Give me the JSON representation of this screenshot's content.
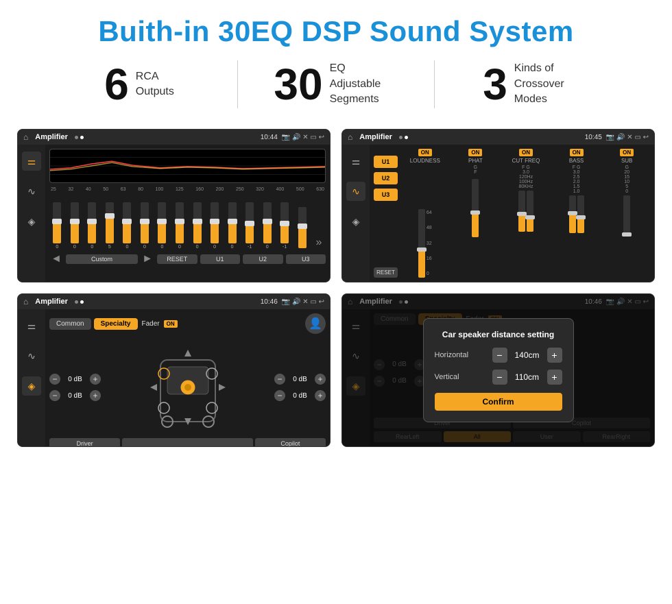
{
  "page": {
    "title": "Buith-in 30EQ DSP Sound System"
  },
  "stats": [
    {
      "number": "6",
      "label": "RCA\nOutputs"
    },
    {
      "number": "30",
      "label": "EQ Adjustable\nSegments"
    },
    {
      "number": "3",
      "label": "Kinds of\nCrossover Modes"
    }
  ],
  "screens": [
    {
      "id": "eq-screen",
      "status_bar": {
        "app": "Amplifier",
        "time": "10:44"
      }
    },
    {
      "id": "crossover-screen",
      "status_bar": {
        "app": "Amplifier",
        "time": "10:45"
      }
    },
    {
      "id": "fader-screen",
      "status_bar": {
        "app": "Amplifier",
        "time": "10:46"
      }
    },
    {
      "id": "distance-screen",
      "status_bar": {
        "app": "Amplifier",
        "time": "10:46"
      },
      "dialog": {
        "title": "Car speaker distance setting",
        "horizontal_label": "Horizontal",
        "horizontal_value": "140cm",
        "vertical_label": "Vertical",
        "vertical_value": "110cm",
        "confirm_label": "Confirm"
      }
    }
  ],
  "eq": {
    "freqs": [
      "25",
      "32",
      "40",
      "50",
      "63",
      "80",
      "100",
      "125",
      "160",
      "200",
      "250",
      "320",
      "400",
      "500",
      "630"
    ],
    "values": [
      "0",
      "0",
      "0",
      "5",
      "0",
      "0",
      "0",
      "0",
      "0",
      "0",
      "0",
      "-1",
      "0",
      "-1",
      ""
    ],
    "presets": [
      "Custom",
      "RESET",
      "U1",
      "U2",
      "U3"
    ]
  },
  "crossover": {
    "presets": [
      "U1",
      "U2",
      "U3"
    ],
    "channels": [
      "LOUDNESS",
      "PHAT",
      "CUT FREQ",
      "BASS",
      "SUB"
    ],
    "reset": "RESET"
  },
  "fader": {
    "modes": [
      "Common",
      "Specialty"
    ],
    "label": "Fader",
    "on": "ON",
    "volumes": [
      "0 dB",
      "0 dB",
      "0 dB",
      "0 dB"
    ],
    "bottom_btns": [
      "Driver",
      "",
      "Copilot",
      "RearLeft",
      "All",
      "User",
      "RearRight"
    ]
  }
}
